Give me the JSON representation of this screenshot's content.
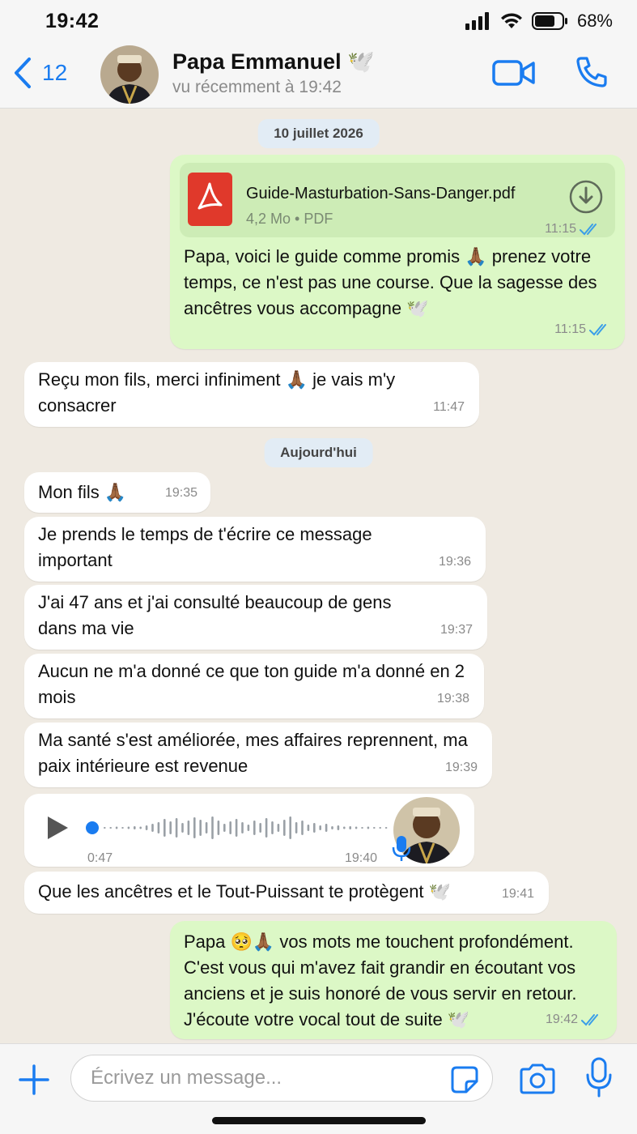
{
  "status_bar": {
    "time": "19:42",
    "battery": "68%"
  },
  "header": {
    "back_count": "12",
    "contact_name": "Papa Emmanuel 🕊️",
    "contact_status": "vu récemment à 19:42"
  },
  "colors": {
    "accent": "#1a7cf0",
    "outgoing": "#dcf8c6",
    "incoming": "#ffffff",
    "ticks": "#3a9ee8",
    "pdf_red": "#e0392b"
  },
  "chat": {
    "date1": "10 juillet 2026",
    "date2": "Aujourd'hui",
    "pdf": {
      "name": "Guide-Masturbation-Sans-Danger.pdf",
      "meta": "4,2 Mo • PDF",
      "time": "11:15"
    },
    "messages": [
      {
        "dir": "out",
        "text": "Papa, voici le guide comme promis 🙏🏾 prenez votre temps, ce n'est pas une course. Que la sagesse des ancêtres vous accompagne 🕊️",
        "time": "11:15"
      },
      {
        "dir": "in",
        "text": "Reçu mon fils, merci infiniment 🙏🏾 je vais m'y consacrer",
        "time": "11:47"
      },
      {
        "dir": "in",
        "text": "Mon fils 🙏🏾",
        "time": "19:35"
      },
      {
        "dir": "in",
        "text": "Je prends le temps de t'écrire ce message important",
        "time": "19:36"
      },
      {
        "dir": "in",
        "text": "J'ai 47 ans et j'ai consulté beaucoup de gens dans ma vie",
        "time": "19:37"
      },
      {
        "dir": "in",
        "text": "Aucun ne m'a donné ce que ton guide m'a donné en 2 mois",
        "time": "19:38"
      },
      {
        "dir": "in",
        "text": "Ma santé s'est améliorée, mes affaires reprennent, ma paix intérieure est revenue",
        "time": "19:39"
      },
      {
        "dir": "in",
        "text": "Que les ancêtres et le Tout-Puissant te protègent 🕊️",
        "time": "19:41"
      },
      {
        "dir": "out",
        "text": "Papa 🥺🙏🏾 vos mots me touchent profondément. C'est vous qui m'avez fait grandir en écoutant vos anciens et je suis honoré de vous servir en retour. J'écoute votre vocal tout de suite 🕊️",
        "time": "19:42"
      }
    ],
    "voice": {
      "duration": "0:47",
      "time": "19:40"
    }
  },
  "composer": {
    "placeholder": "Écrivez un message..."
  },
  "icons": [
    "back-chevron-icon",
    "video-call-icon",
    "phone-icon",
    "pdf-icon",
    "download-icon",
    "double-check-icon",
    "play-icon",
    "microphone-icon",
    "plus-icon",
    "sticker-icon",
    "camera-icon"
  ]
}
